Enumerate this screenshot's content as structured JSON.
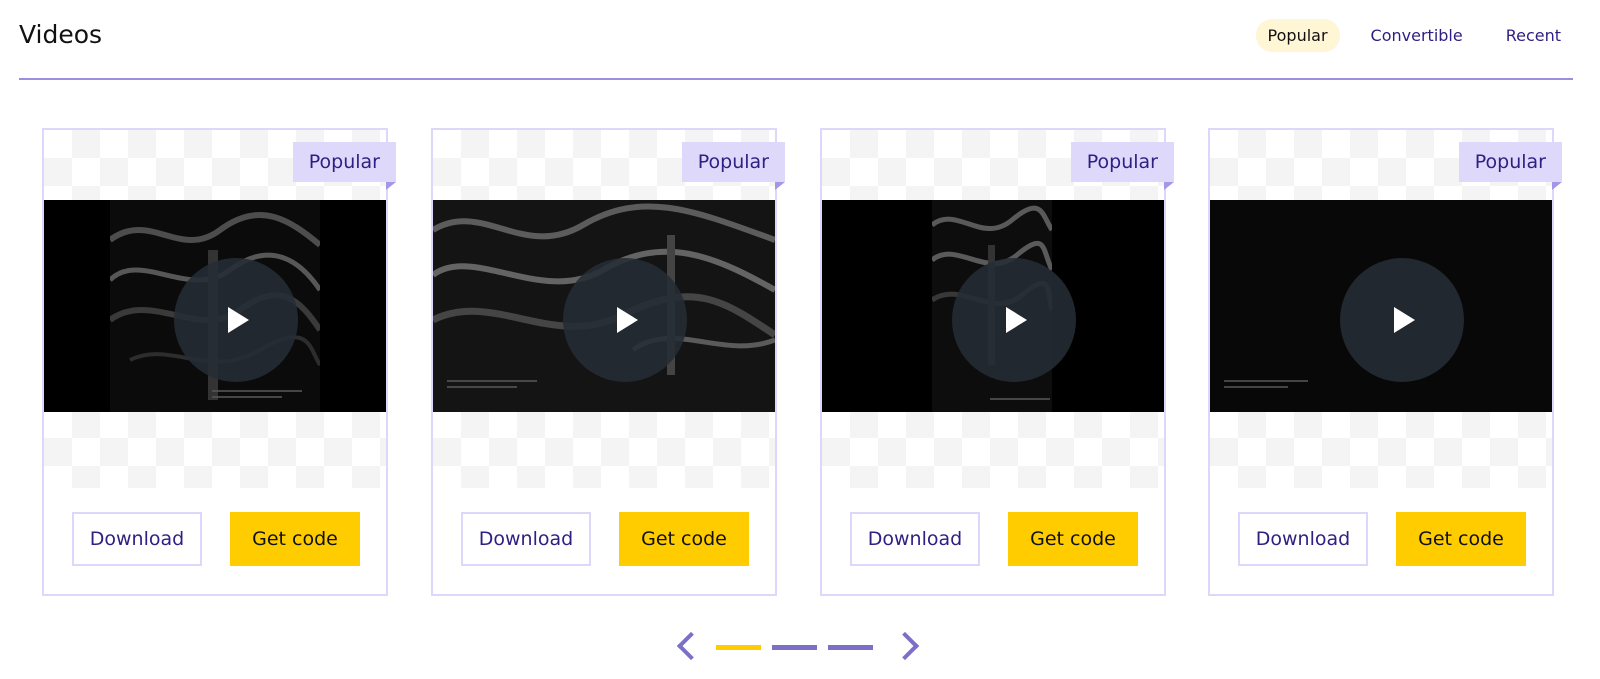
{
  "header": {
    "title": "Videos",
    "tabs": [
      {
        "label": "Popular",
        "active": true
      },
      {
        "label": "Convertible",
        "active": false
      },
      {
        "label": "Recent",
        "active": false
      }
    ]
  },
  "cards": [
    {
      "badge": "Popular",
      "download_label": "Download",
      "code_label": "Get code",
      "icon": "play-icon"
    },
    {
      "badge": "Popular",
      "download_label": "Download",
      "code_label": "Get code",
      "icon": "play-icon"
    },
    {
      "badge": "Popular",
      "download_label": "Download",
      "code_label": "Get code",
      "icon": "play-icon"
    },
    {
      "badge": "Popular",
      "download_label": "Download",
      "code_label": "Get code",
      "icon": "play-icon"
    }
  ],
  "pagination": {
    "pages": 3,
    "current": 1,
    "prev_icon": "chevron-left-icon",
    "next_icon": "chevron-right-icon"
  },
  "colors": {
    "accent": "#2e1f82",
    "badge_bg": "#ded8fb",
    "primary_button": "#ffcc00",
    "divider": "#9b8fe0",
    "pager": "#7b6fc8"
  }
}
